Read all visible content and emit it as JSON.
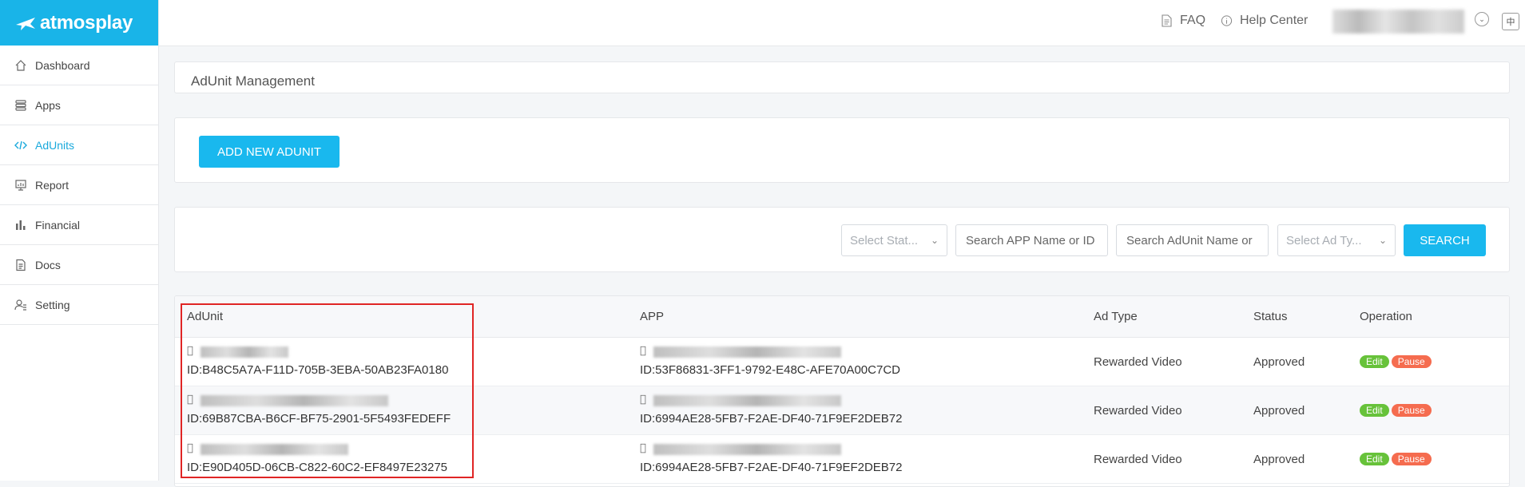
{
  "brand": {
    "name": "atmosplay"
  },
  "sidebar": {
    "items": [
      {
        "label": "Dashboard",
        "icon": "home-icon",
        "active": false
      },
      {
        "label": "Apps",
        "icon": "layers-icon",
        "active": false
      },
      {
        "label": "AdUnits",
        "icon": "code-icon",
        "active": true
      },
      {
        "label": "Report",
        "icon": "report-icon",
        "active": false
      },
      {
        "label": "Financial",
        "icon": "bar-chart-icon",
        "active": false
      },
      {
        "label": "Docs",
        "icon": "document-icon",
        "active": false
      },
      {
        "label": "Setting",
        "icon": "user-settings-icon",
        "active": false
      }
    ]
  },
  "header": {
    "faq": "FAQ",
    "help": "Help Center",
    "lang": "中"
  },
  "page": {
    "title": "AdUnit Management",
    "add_button": "ADD NEW ADUNIT"
  },
  "filters": {
    "status_placeholder": "Select Stat...",
    "app_placeholder": "Search APP Name or ID",
    "adunit_placeholder": "Search AdUnit Name or",
    "adtype_placeholder": "Select Ad Ty...",
    "search_button": "SEARCH"
  },
  "table": {
    "headers": {
      "adunit": "AdUnit",
      "app": "APP",
      "ad_type": "Ad Type",
      "status": "Status",
      "operation": "Operation"
    },
    "rows": [
      {
        "adunit_id": "ID:B48C5A7A-F11D-705B-3EBA-50AB23FA0180",
        "app_id": "ID:53F86831-3FF1-9792-E48C-AFE70A00C7CD",
        "ad_type": "Rewarded Video",
        "status": "Approved",
        "edit": "Edit",
        "pause": "Pause"
      },
      {
        "adunit_id": "ID:69B87CBA-B6CF-BF75-2901-5F5493FEDEFF",
        "app_id": "ID:6994AE28-5FB7-F2AE-DF40-71F9EF2DEB72",
        "ad_type": "Rewarded Video",
        "status": "Approved",
        "edit": "Edit",
        "pause": "Pause"
      },
      {
        "adunit_id": "ID:E90D405D-06CB-C822-60C2-EF8497E23275",
        "app_id": "ID:6994AE28-5FB7-F2AE-DF40-71F9EF2DEB72",
        "ad_type": "Rewarded Video",
        "status": "Approved",
        "edit": "Edit",
        "pause": "Pause"
      }
    ]
  },
  "colors": {
    "brand": "#19b4e8",
    "primary_button": "#19b8ee",
    "edit": "#67c23a",
    "pause": "#f56c4f",
    "highlight": "#e02525"
  }
}
